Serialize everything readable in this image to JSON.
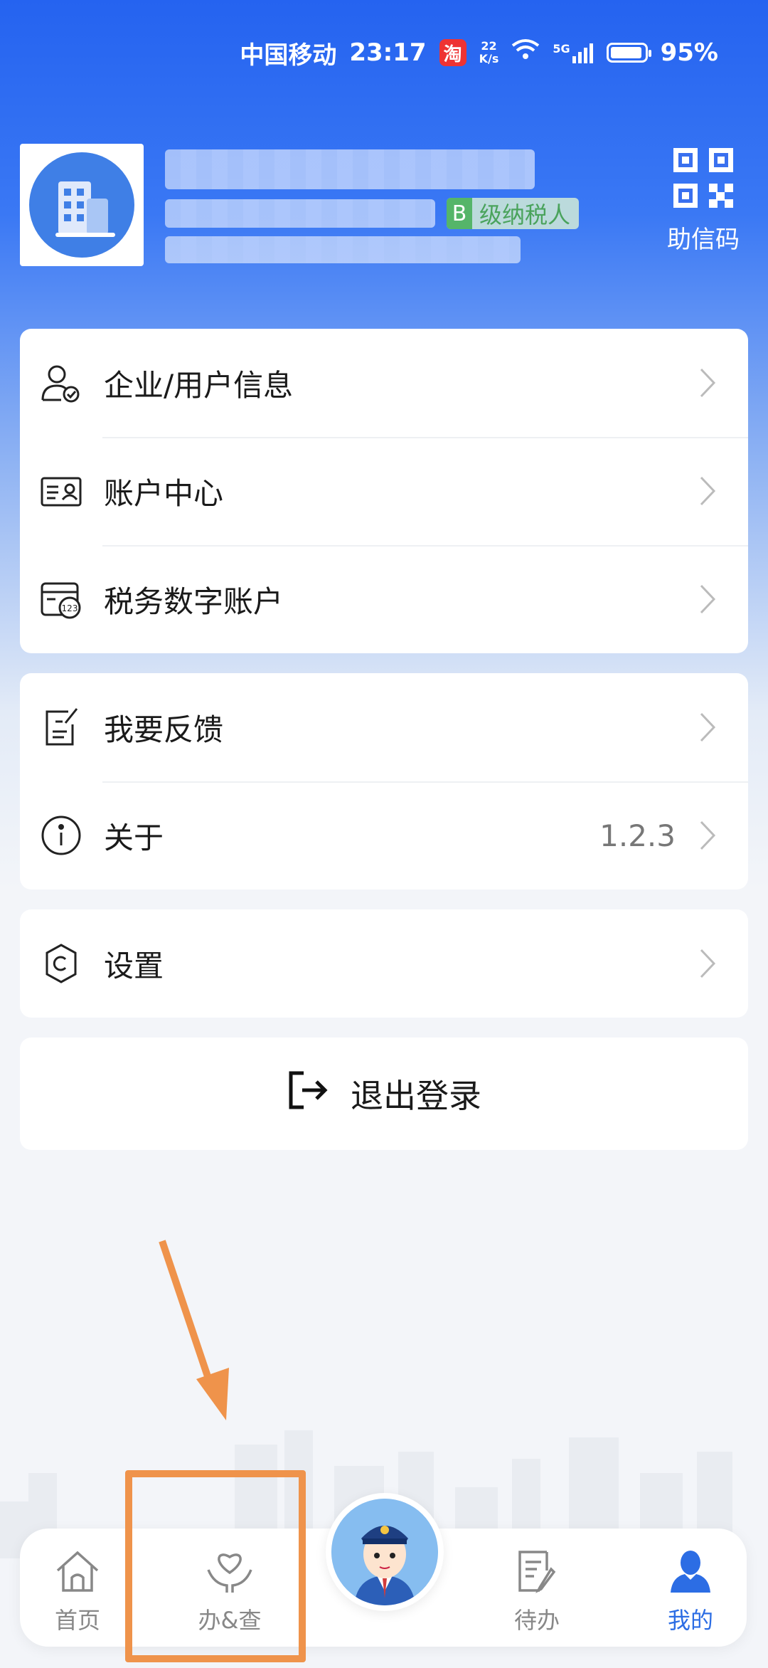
{
  "status_bar": {
    "carrier": "中国移动",
    "time": "23:17",
    "app_badge": "淘",
    "net_speed_value": "22",
    "net_speed_unit": "K/s",
    "network": "5G",
    "battery": "95%",
    "battery_level": 0.95
  },
  "profile": {
    "taxpayer_level_letter": "B",
    "taxpayer_level_text": "级纳税人",
    "qr_label": "助信码"
  },
  "menu_group_1": [
    {
      "label": "企业/用户信息",
      "icon": "user-check-icon"
    },
    {
      "label": "账户中心",
      "icon": "id-card-icon"
    },
    {
      "label": "税务数字账户",
      "icon": "digital-account-icon"
    }
  ],
  "menu_group_2": [
    {
      "label": "我要反馈",
      "icon": "feedback-icon"
    },
    {
      "label": "关于",
      "icon": "info-icon",
      "value": "1.2.3"
    }
  ],
  "menu_group_3": [
    {
      "label": "设置",
      "icon": "settings-icon"
    }
  ],
  "logout": {
    "label": "退出登录",
    "icon": "logout-icon"
  },
  "tabbar": {
    "items": [
      {
        "label": "首页",
        "icon": "home-icon",
        "active": false
      },
      {
        "label": "办&查",
        "icon": "heart-hand-icon",
        "active": false
      },
      {
        "label": "待办",
        "icon": "todo-icon",
        "active": false
      },
      {
        "label": "我的",
        "icon": "person-icon",
        "active": true
      }
    ],
    "center": {
      "icon": "tax-officer-avatar-icon"
    }
  },
  "colors": {
    "primary": "#2c6de4",
    "annotation": "#ef934b",
    "badge_green": "#55b569"
  }
}
